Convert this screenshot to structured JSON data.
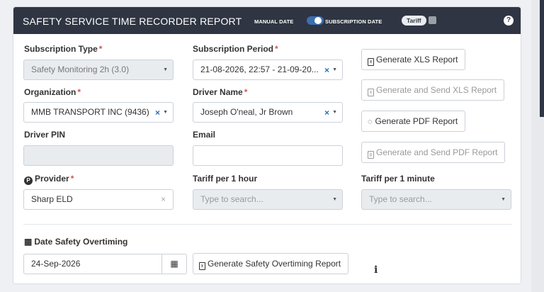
{
  "header": {
    "title": "SAFETY SERVICE TIME RECORDER REPORT",
    "manual_date": "MANUAL DATE",
    "subscription_date": "SUBSCRIPTION DATE",
    "tariff": "Tariff",
    "help": "?"
  },
  "form": {
    "subscription_type": {
      "label": "Subscription Type",
      "value": "Safety Monitoring 2h (3.0)"
    },
    "subscription_period": {
      "label": "Subscription Period",
      "value": "21-08-2026, 22:57 - 21-09-20..."
    },
    "organization": {
      "label": "Organization",
      "value": "MMB TRANSPORT INC (9436)"
    },
    "driver_name": {
      "label": "Driver Name",
      "value": "Joseph O'neal, Jr Brown"
    },
    "driver_pin": {
      "label": "Driver PIN",
      "value": ""
    },
    "email": {
      "label": "Email",
      "value": ""
    },
    "provider": {
      "label": "Provider",
      "value": "Sharp ELD"
    },
    "tariff_hour": {
      "label": "Tariff per 1 hour",
      "placeholder": "Type to search..."
    },
    "tariff_minute": {
      "label": "Tariff per 1 minute",
      "placeholder": "Type to search..."
    },
    "date_overtiming": {
      "label": "Date Safety Overtiming",
      "value": "24-Sep-2026"
    },
    "required_mark": "*"
  },
  "buttons": {
    "gen_xls": "Generate XLS Report",
    "gen_send_xls": "Generate and Send XLS Report",
    "gen_pdf": "Generate PDF Report",
    "gen_send_pdf": "Generate and Send PDF Report",
    "gen_overtiming": "Generate Safety Overtiming Report"
  },
  "icons": [
    "xls-file-icon",
    "pdf-file-icon",
    "spinner-icon",
    "calendar-icon",
    "provider-icon",
    "info-icon",
    "help-icon",
    "clear-icon",
    "chevron-down-icon"
  ],
  "colors": {
    "header_bg": "#2f3542",
    "required": "#d9534f",
    "clear_icon": "#2a6fb8",
    "toggle": "#3a6fb0"
  }
}
